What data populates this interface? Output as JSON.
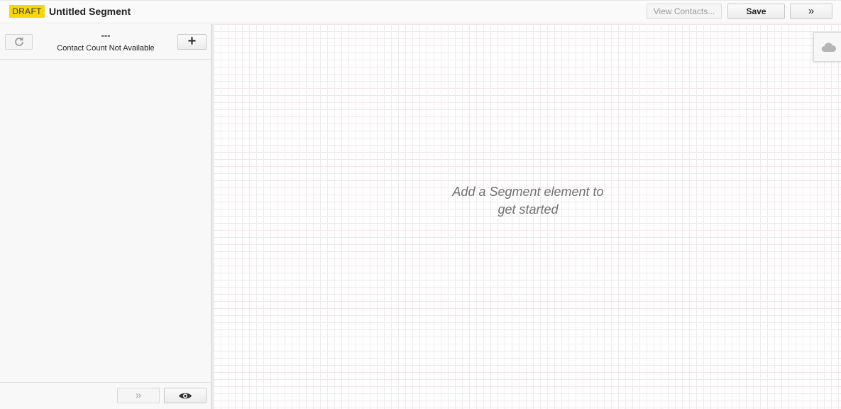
{
  "header": {
    "badge": "DRAFT",
    "title": "Untitled Segment",
    "view_contacts_label": "View Contacts...",
    "save_label": "Save",
    "expand_label": "»"
  },
  "left_panel": {
    "count_value": "---",
    "count_label": "Contact Count Not Available",
    "refresh_icon": "refresh-icon",
    "add_icon": "plus-icon",
    "add_label": "+",
    "collapse_label": "»",
    "preview_icon": "eye-icon"
  },
  "canvas": {
    "hint": "Add a Segment element to get started",
    "cloud_icon": "cloud-icon"
  },
  "colors": {
    "badge": "#f7d50f",
    "grid": "#ececec"
  }
}
